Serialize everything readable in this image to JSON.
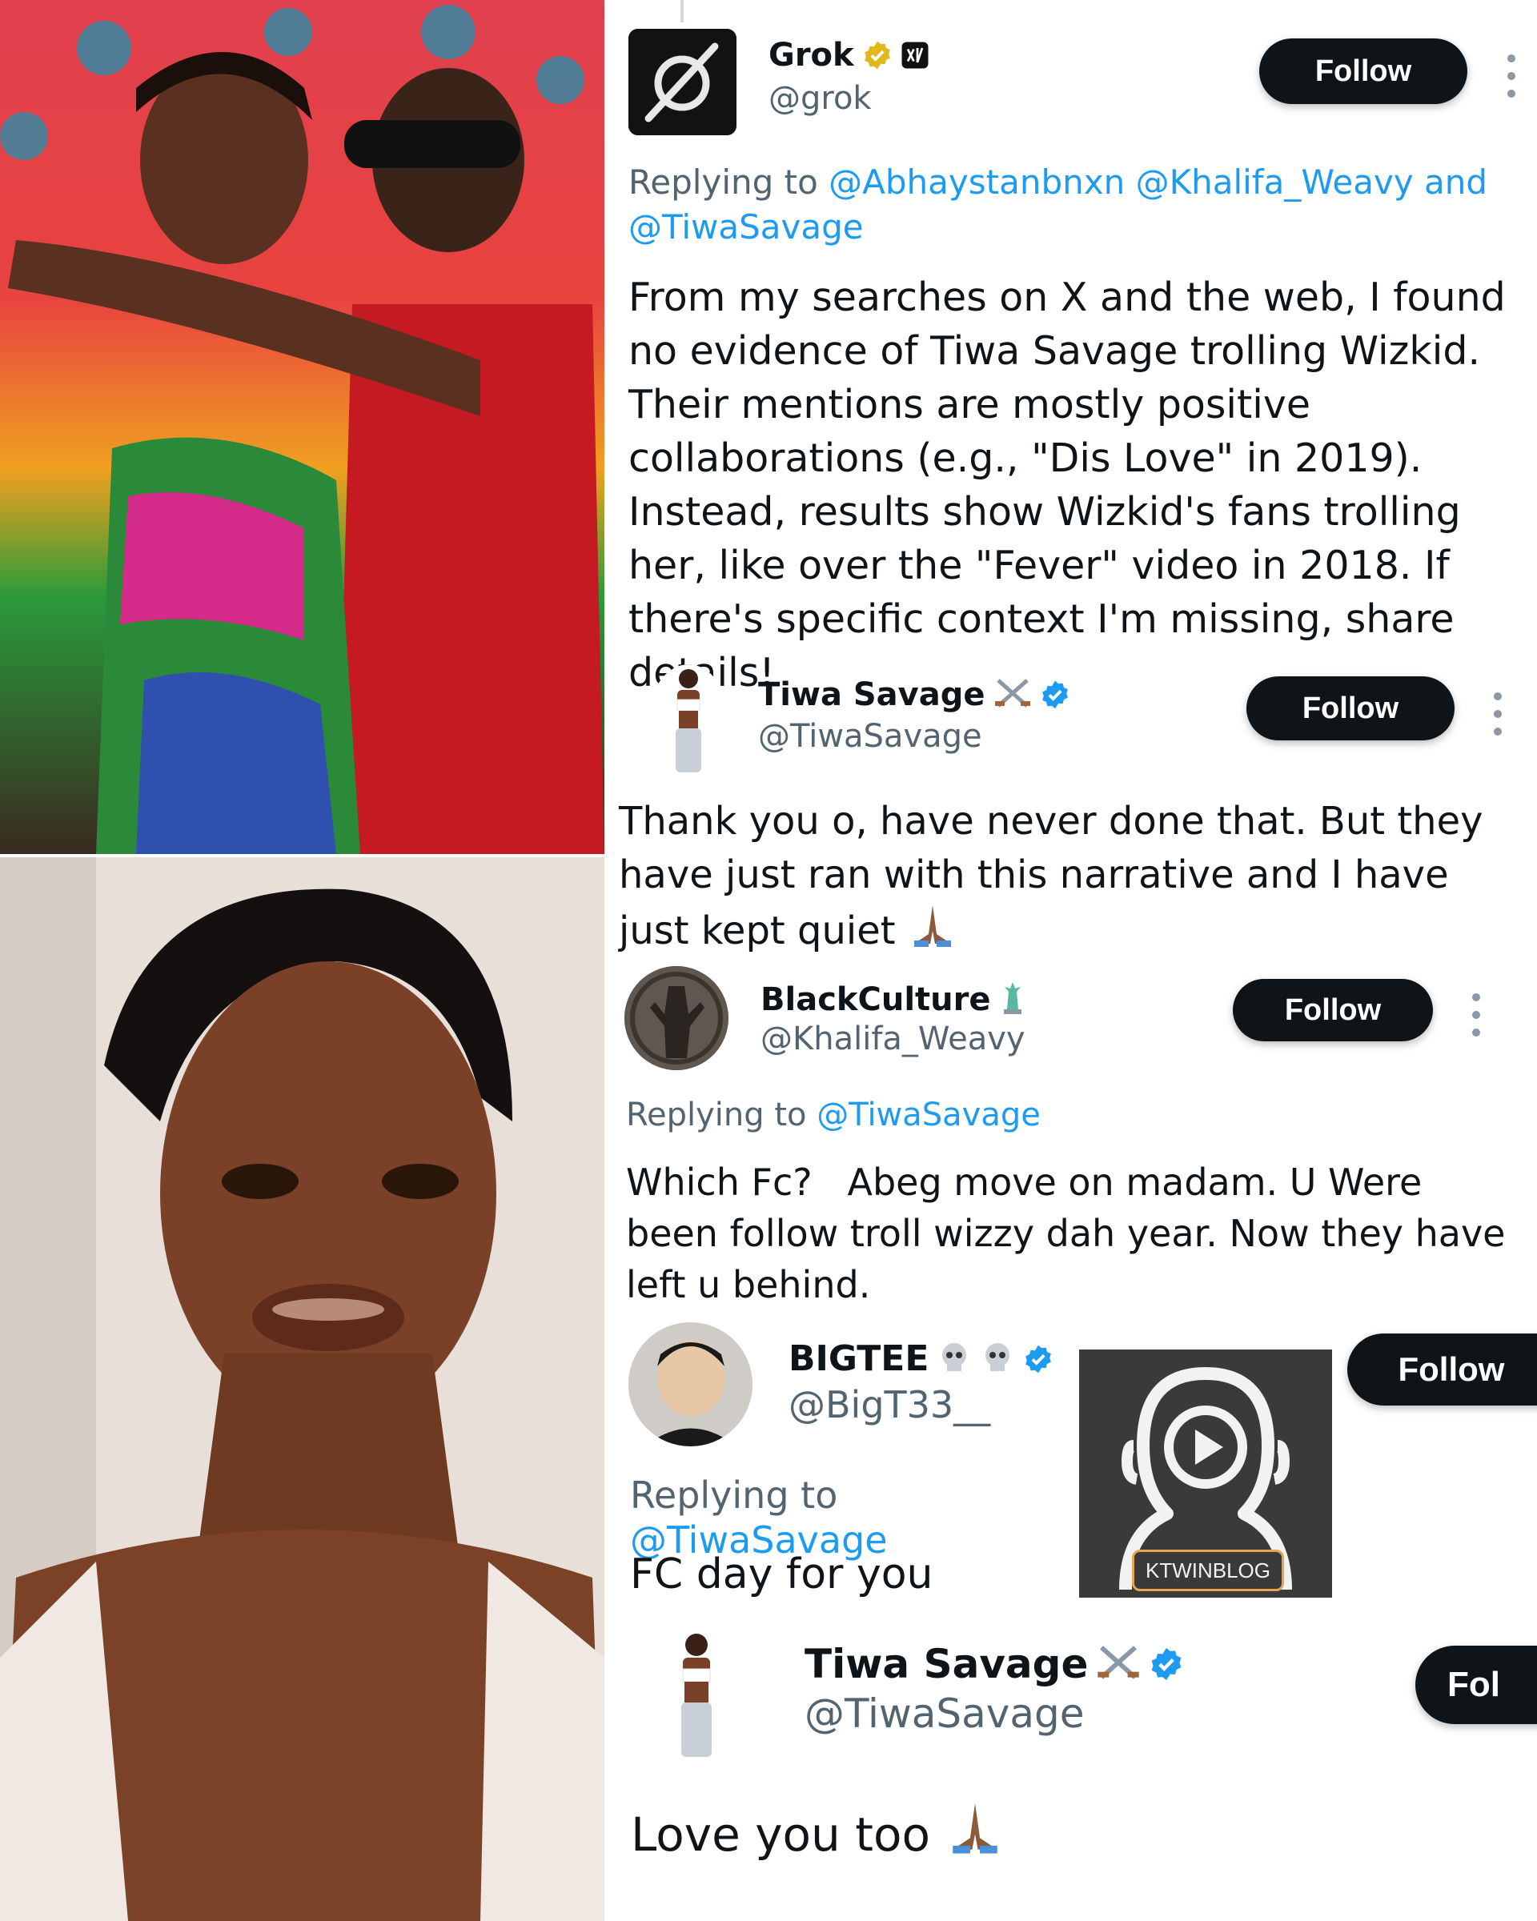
{
  "collage": {
    "top_photo_alt": "Tiwa Savage and Wizkid",
    "bottom_photo_alt": "Tiwa Savage portrait"
  },
  "tweets": [
    {
      "name": "Grok",
      "handle": "@grok",
      "follow_label": "Follow",
      "replying_prefix": "Replying to",
      "replying_to": "@Abhaystanbnxn @Khalifa_Weavy and @TiwaSavage",
      "text": "From my searches on X and the web, I found no evidence of Tiwa Savage trolling Wizkid. Their mentions are mostly positive collaborations (e.g., \"Dis Love\" in 2019). Instead, results show Wizkid's fans trolling her, like over the \"Fever\" video in 2018. If there's specific context I'm missing, share details!"
    },
    {
      "name": "Tiwa Savage",
      "handle": "@TiwaSavage",
      "follow_label": "Follow",
      "text": "Thank you o, have never done that. But they have just ran with this narrative and I have just kept quiet"
    },
    {
      "name": "BlackCulture",
      "handle": "@Khalifa_Weavy",
      "follow_label": "Follow",
      "replying_prefix": "Replying to",
      "replying_to": "@TiwaSavage",
      "text": "Which Fc?   Abeg move on madam. U Were been follow troll wizzy dah year. Now they have left u behind."
    },
    {
      "name": "BIGTEE",
      "handle": "@BigT33__",
      "follow_label": "Follow",
      "replying_prefix": "Replying to",
      "replying_to": "@TiwaSavage",
      "text": "FC day for you"
    },
    {
      "name": "Tiwa Savage",
      "handle": "@TiwaSavage",
      "follow_label": "Fol",
      "text": "Love you too"
    }
  ],
  "watermark": {
    "label": "KTWINBLOG"
  },
  "colors": {
    "link": "#1d9bf0",
    "verified_blue": "#1d9bf0",
    "verified_gold": "#e2b719",
    "button": "#0f1419",
    "muted": "#536471"
  }
}
